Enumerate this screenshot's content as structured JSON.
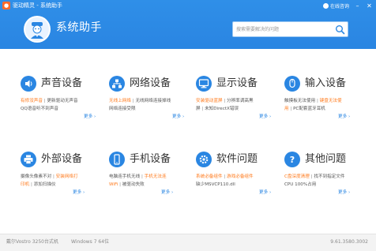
{
  "titlebar": {
    "title": "驱动精灵 - 系统助手",
    "online_help": "在线咨询",
    "min_icon": "minimize-icon",
    "close_icon": "close-icon"
  },
  "header": {
    "brand": "系统助手",
    "search": {
      "placeholder": "搜索需要解决的问题"
    }
  },
  "cards": [
    {
      "title": "声音设备",
      "icon": "speaker-icon",
      "line1_a": "有修没声音",
      "line1_b": "更新驱动无声音",
      "line2_a": "QQ语音听不到声音",
      "more": "更多 ›"
    },
    {
      "title": "网络设备",
      "icon": "network-icon",
      "line1_a": "无线上网络",
      "line1_b": "无线网络连接掉线",
      "line2_a": "网络连接受限",
      "more": "更多 ›"
    },
    {
      "title": "显示设备",
      "icon": "monitor-icon",
      "line1_a": "安装驱动蓝屏",
      "line1_b": "分辨率调高黑",
      "line2_a": "屏",
      "line2_b": "未知DirectX错误",
      "more": "更多 ›"
    },
    {
      "title": "输入设备",
      "icon": "mouse-icon",
      "line1_a": "触摸板无法使用",
      "line1_b": "键盘无法使",
      "line2_a": "用",
      "line2_b": "PC配套蓝牙耳机",
      "more": "更多 ›"
    },
    {
      "title": "外部设备",
      "icon": "printer-icon",
      "line1_a": "摄像头像素不对",
      "line1_b": "安装网络打",
      "line2_a": "印机",
      "line2_b": "添加扫描仪",
      "more": "更多 ›"
    },
    {
      "title": "手机设备",
      "icon": "phone-icon",
      "line1_a": "电脑连手机无线",
      "line1_b": "手机无法连",
      "line2_a": "WiFi",
      "line2_b": "被驱动失败",
      "more": "更多 ›"
    },
    {
      "title": "软件问题",
      "icon": "gear-icon",
      "line1_a": "系统必备组件",
      "line1_b": "游戏必备组件",
      "line2_a": "缺少MSVCP110.dll",
      "more": "更多 ›"
    },
    {
      "title": "其他问题",
      "icon": "question-icon",
      "line1_a": "C盘深度清理",
      "line1_b": "找不到指定文件",
      "line2_a": "CPU 100%占用",
      "more": "更多 ›"
    }
  ],
  "footer": {
    "system": "戴尔Vostro 3250台式机",
    "os": "Windows 7 64位",
    "version": "9.61.3580.3002"
  },
  "colors": {
    "primary": "#2a86e2",
    "orange": "#ff7a1c"
  }
}
